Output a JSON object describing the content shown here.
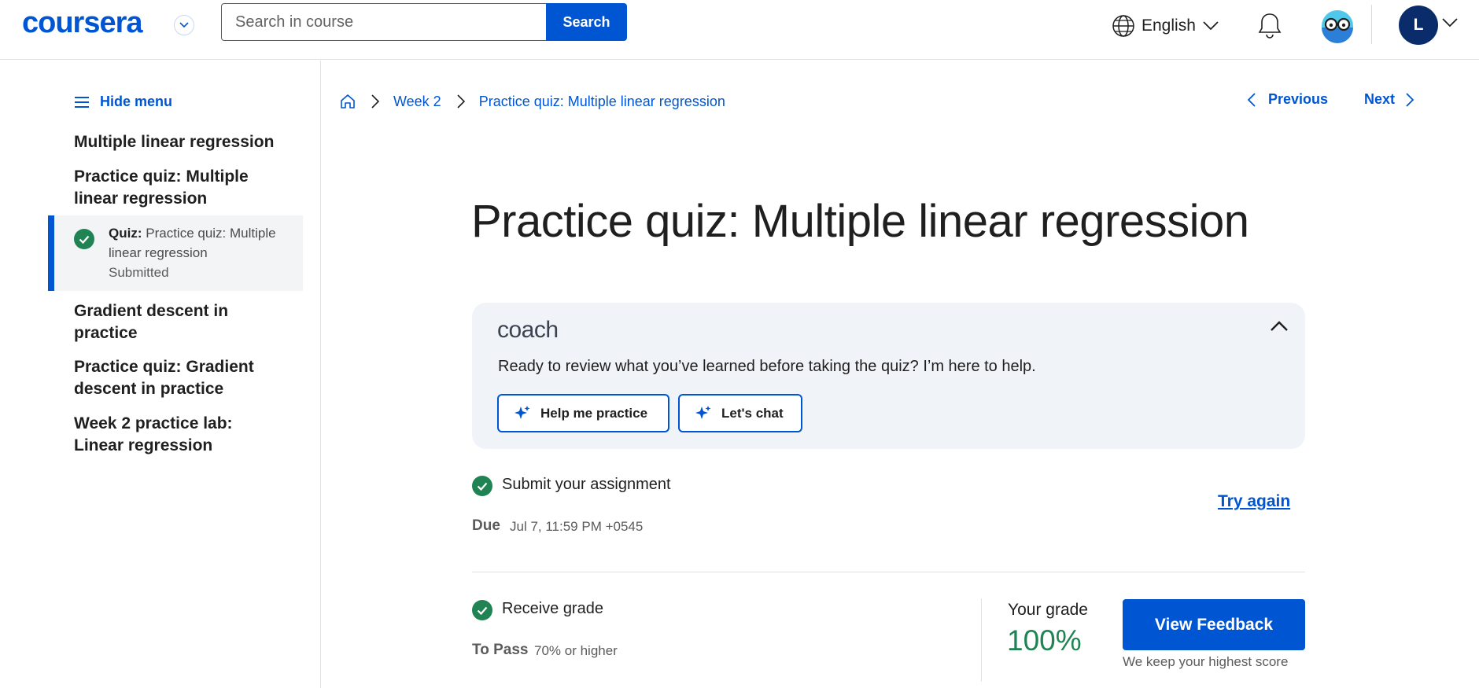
{
  "header": {
    "logo": "coursera",
    "search": {
      "placeholder": "Search in course",
      "value": "",
      "button": "Search"
    },
    "language": "English",
    "avatar_initial": "L",
    "icons": [
      "chevron-down-icon",
      "globe-icon",
      "bell-icon",
      "coach-glasses-icon",
      "avatar"
    ]
  },
  "sidebar": {
    "hide_menu": "Hide menu",
    "items": [
      {
        "label": "Multiple linear regression"
      },
      {
        "label": "Practice quiz: Multiple linear regression"
      },
      {
        "label": "Gradient descent in practice"
      },
      {
        "label": "Practice quiz: Gradient descent in practice"
      },
      {
        "label": "Week 2 practice lab: Linear regression"
      }
    ],
    "active": {
      "type_label": "Quiz:",
      "title": "Practice quiz: Multiple linear regression",
      "status": "Submitted"
    }
  },
  "breadcrumb": {
    "items": [
      "Week 2",
      "Practice quiz: Multiple linear regression"
    ]
  },
  "nav": {
    "previous": "Previous",
    "next": "Next"
  },
  "main": {
    "title": "Practice quiz: Multiple linear regression",
    "coach": {
      "logo": "coach",
      "message": "Ready to review what you’ve learned before taking the quiz? I’m here to help.",
      "buttons": [
        "Help me practice",
        "Let's chat"
      ]
    },
    "submit": {
      "title": "Submit your assignment",
      "due_label": "Due",
      "due_value": "Jul 7, 11:59 PM +0545",
      "try_again": "Try again"
    },
    "grade": {
      "title": "Receive grade",
      "to_pass_label": "To Pass",
      "to_pass_value": "70% or higher",
      "your_grade_label": "Your grade",
      "your_grade_value": "100%",
      "view_feedback": "View Feedback",
      "note": "We keep your highest score"
    }
  },
  "colors": {
    "brand": "#0056d2",
    "success": "#1f8354",
    "coach_bg": "#f0f3f8",
    "active_bg": "#f3f4f6"
  }
}
